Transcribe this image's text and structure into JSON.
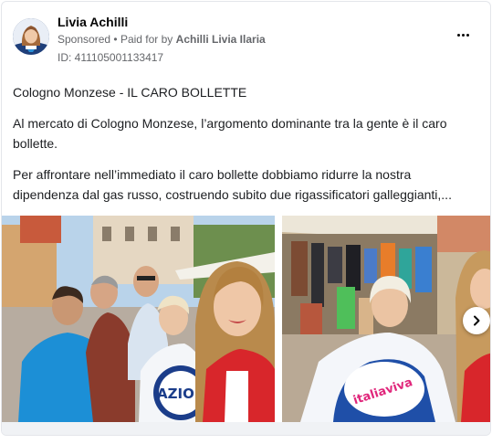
{
  "post": {
    "author": "Livia Achilli",
    "sponsored_label": "Sponsored",
    "paid_for_prefix": "Paid for by",
    "paid_for_by": "Achilli Livia Ilaria",
    "ad_id": "ID: 411105001133417",
    "paragraphs": [
      "Cologno Monzese - IL CARO BOLLETTE",
      "Al mercato di Cologno Monzese, l’argomento dominante tra la gente è il caro bollette.",
      "Per affrontare nell’immediato il caro bollette dobbiamo ridurre la nostra dipendenza dal gas russo, costruendo subito due rigassificatori galleggianti,..."
    ],
    "images": [
      {
        "icon": "selfie-photo",
        "flag_text": "AZION"
      },
      {
        "icon": "market-photo",
        "flag_text": "italiaviva"
      }
    ],
    "next_icon": "chevron-right-icon",
    "more_icon": "more-options-icon"
  },
  "colors": {
    "text": "#1c1e21",
    "secondary": "#65676b",
    "border": "#e4e6eb",
    "accent": "#1877f2"
  }
}
